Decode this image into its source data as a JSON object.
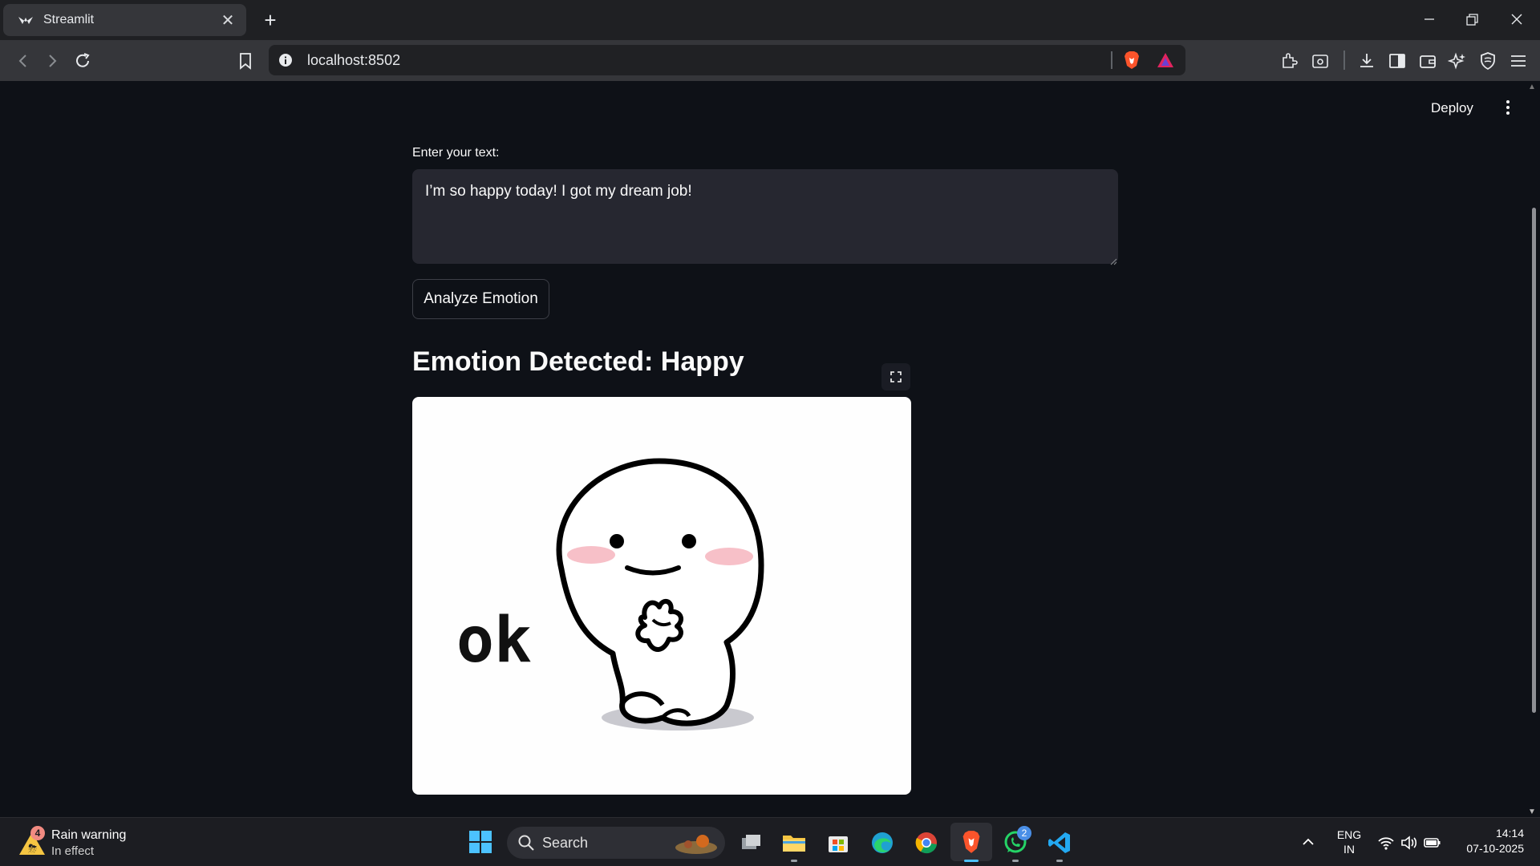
{
  "browser": {
    "tab_title": "Streamlit",
    "url": "localhost:8502"
  },
  "app": {
    "deploy_label": "Deploy",
    "input_label": "Enter your text:",
    "input_value": "I’m so happy today! I got my dream job!",
    "analyze_button": "Analyze Emotion",
    "result_title": "Emotion Detected: Happy",
    "image_text": "ok"
  },
  "taskbar": {
    "weather_badge": "4",
    "weather_title": "Rain warning",
    "weather_status": "In effect",
    "search_label": "Search",
    "whatsapp_badge": "2",
    "lang_line1": "ENG",
    "lang_line2": "IN",
    "time": "14:14",
    "date": "07-10-2025"
  },
  "icons": [
    "streamlit-favicon",
    "close-icon",
    "plus-icon",
    "minimize-icon",
    "restore-icon",
    "window-close-icon",
    "back-icon",
    "forward-icon",
    "reload-icon",
    "bookmark-icon",
    "info-icon",
    "brave-shields-icon",
    "brave-rewards-icon",
    "extensions-icon",
    "screenshot-icon",
    "download-icon",
    "sidebar-icon",
    "wallet-icon",
    "leo-ai-icon",
    "vpn-icon",
    "menu-icon",
    "kebab-menu-icon",
    "fullscreen-icon",
    "windows-start-icon",
    "search-icon",
    "file-explorer-icon",
    "edge-icon",
    "chrome-icon",
    "brave-icon",
    "whatsapp-icon",
    "vscode-icon",
    "wifi-icon",
    "volume-icon",
    "battery-icon"
  ]
}
